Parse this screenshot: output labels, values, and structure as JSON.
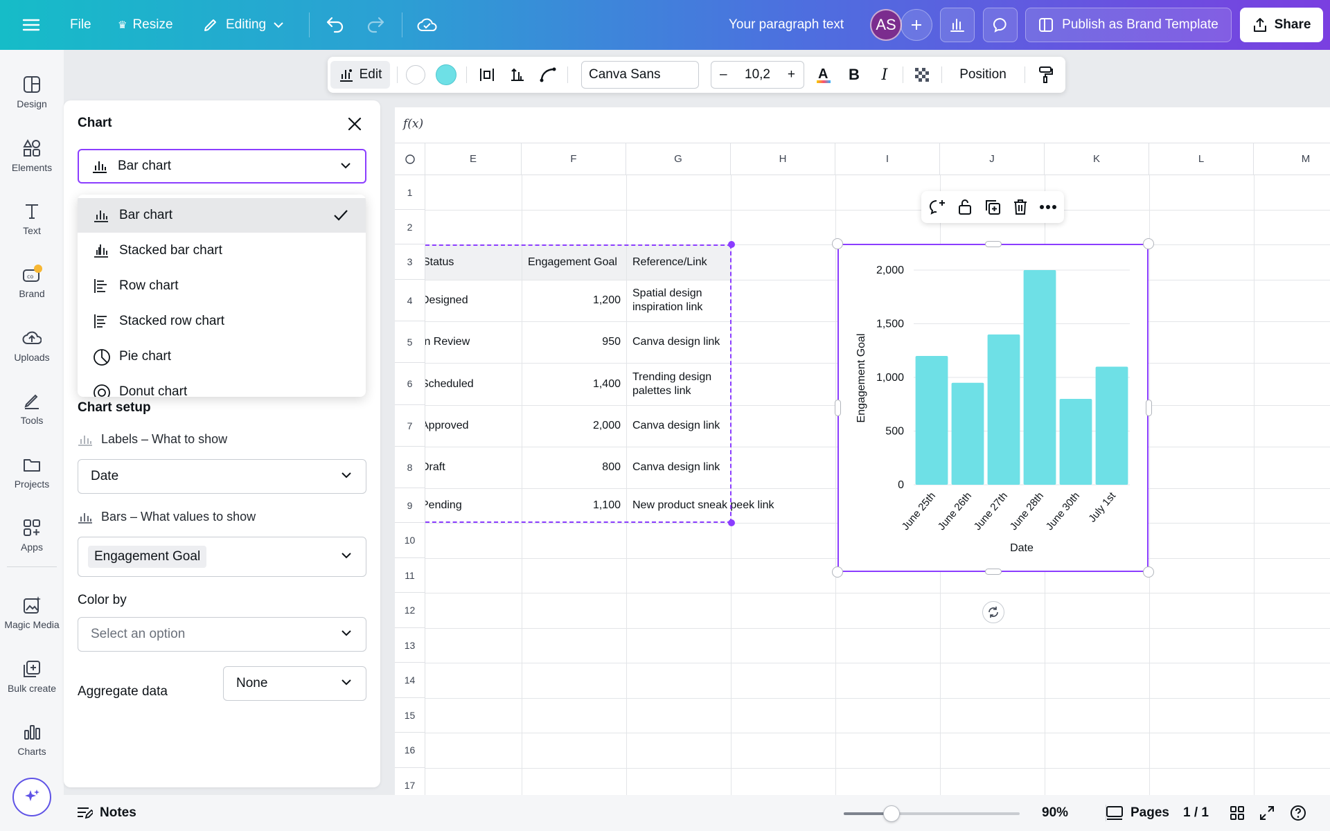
{
  "topbar": {
    "file": "File",
    "resize": "Resize",
    "editing": "Editing",
    "design_title": "Your paragraph text",
    "avatar_initials": "AS",
    "publish": "Publish as Brand Template",
    "share": "Share"
  },
  "rail": {
    "items": [
      {
        "label": "Design",
        "icon": "design-icon"
      },
      {
        "label": "Elements",
        "icon": "elements-icon"
      },
      {
        "label": "Text",
        "icon": "text-icon"
      },
      {
        "label": "Brand",
        "icon": "brand-icon"
      },
      {
        "label": "Uploads",
        "icon": "uploads-icon"
      },
      {
        "label": "Tools",
        "icon": "tools-icon"
      },
      {
        "label": "Projects",
        "icon": "projects-icon"
      },
      {
        "label": "Apps",
        "icon": "apps-icon"
      },
      {
        "label": "Magic Media",
        "icon": "magic-media-icon"
      },
      {
        "label": "Bulk create",
        "icon": "bulk-create-icon"
      },
      {
        "label": "Charts",
        "icon": "charts-icon"
      }
    ]
  },
  "panel": {
    "title": "Chart",
    "chart_type": "Bar chart",
    "dropdown": {
      "options": [
        "Bar chart",
        "Stacked bar chart",
        "Row chart",
        "Stacked row chart",
        "Pie chart",
        "Donut chart"
      ],
      "selected": "Bar chart"
    },
    "setup_title": "Chart setup",
    "labels_field": "Labels – What to show",
    "labels_value": "Date",
    "bars_field": "Bars – What values to show",
    "bars_value": "Engagement Goal",
    "color_by": "Color by",
    "color_placeholder": "Select an option",
    "aggregate": "Aggregate data",
    "aggregate_value": "None"
  },
  "toolbar": {
    "edit": "Edit",
    "font": "Canva Sans",
    "font_size": "10,2",
    "minus": "–",
    "plus": "+",
    "position": "Position",
    "fill_color": "#6ee0e6"
  },
  "sheet": {
    "fx": "f(x)",
    "columns": [
      "E",
      "F",
      "G",
      "H",
      "I",
      "J",
      "K",
      "L",
      "M"
    ],
    "rows": [
      "1",
      "2",
      "3",
      "4",
      "5",
      "6",
      "7",
      "8",
      "9",
      "10",
      "11",
      "12",
      "13",
      "14",
      "15",
      "16",
      "17"
    ],
    "header": {
      "status": "Status",
      "goal": "Engagement Goal",
      "ref": "Reference/Link"
    },
    "data": [
      {
        "status": "Designed",
        "goal": "1,200",
        "ref": "Spatial design inspiration link"
      },
      {
        "status": "In Review",
        "goal": "950",
        "ref": "Canva design link"
      },
      {
        "status": "Scheduled",
        "goal": "1,400",
        "ref": "Trending design palettes link"
      },
      {
        "status": "Approved",
        "goal": "2,000",
        "ref": "Canva design link"
      },
      {
        "status": "Draft",
        "goal": "800",
        "ref": "Canva design link"
      },
      {
        "status": "Pending",
        "goal": "1,100",
        "ref": "New product sneak peek link"
      }
    ]
  },
  "chart_data": {
    "type": "bar",
    "categories": [
      "June 25th",
      "June 26th",
      "June 27th",
      "June 28th",
      "June 30th",
      "July 1st"
    ],
    "values": [
      1200,
      950,
      1400,
      2000,
      800,
      1100
    ],
    "xlabel": "Date",
    "ylabel": "Engagement Goal",
    "yticks": [
      "0",
      "500",
      "1,000",
      "1,500",
      "2,000"
    ],
    "ylim": [
      0,
      2000
    ],
    "color": "#6ee0e6",
    "grid": true
  },
  "bottombar": {
    "notes": "Notes",
    "zoom": "90%",
    "zoom_level": 0.27,
    "pages": "Pages",
    "page_count": "1 / 1"
  },
  "colors": {
    "accent": "#8b3dff",
    "bar": "#6ee0e6"
  }
}
